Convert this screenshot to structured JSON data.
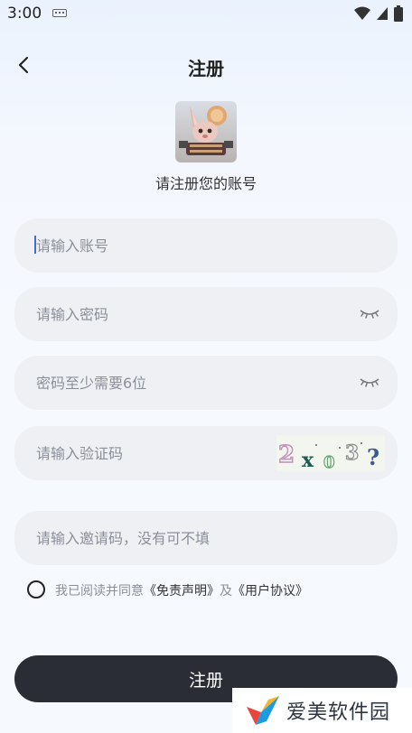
{
  "status_bar": {
    "time": "3:00"
  },
  "nav": {
    "title": "注册"
  },
  "header": {
    "subtitle": "请注册您的账号"
  },
  "form": {
    "account_placeholder": "请输入账号",
    "password_placeholder": "请输入密码",
    "confirm_placeholder": "密码至少需要6位",
    "captcha_placeholder": "请输入验证码",
    "captcha_chars": [
      "2",
      "x",
      "0",
      "3",
      "?"
    ],
    "invite_placeholder": "请输入邀请码，没有可不填"
  },
  "agreement": {
    "prefix": "我已阅读并同意",
    "disclaimer_link": "《免责声明》",
    "joiner": "及",
    "user_agreement_link": "《用户协议》"
  },
  "submit_label": "注册",
  "watermark": {
    "text": "爱美软件园"
  },
  "colors": {
    "button_bg": "#2b2d36",
    "field_bg": "#eef0f4",
    "accent": "#3b6fd4"
  }
}
